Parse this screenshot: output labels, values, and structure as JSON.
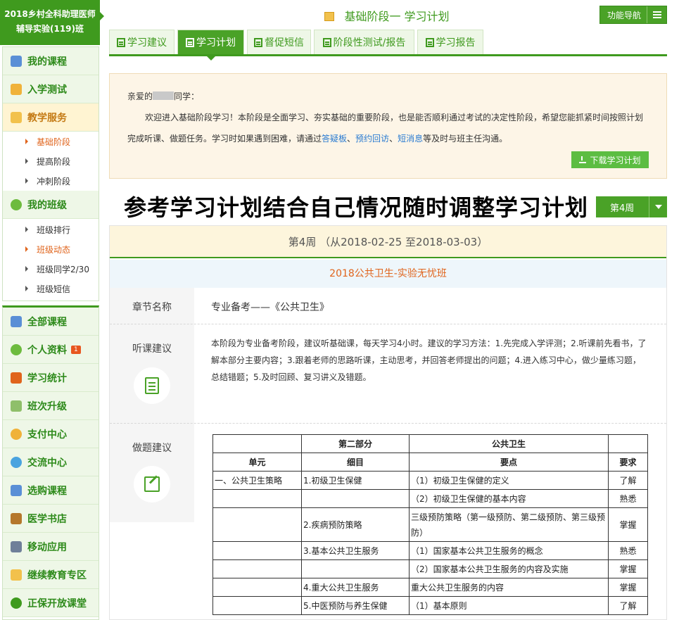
{
  "sidebar": {
    "class_title_line1": "2018乡村全科助理医师",
    "class_title_line2": "辅导实验(119)班",
    "my_courses": "我的课程",
    "entry_test": "入学测试",
    "teaching_service": "教学服务",
    "stage_basic": "基础阶段",
    "stage_advanced": "提高阶段",
    "stage_sprint": "冲刺阶段",
    "my_class": "我的班级",
    "class_ranking": "班级排行",
    "class_news": "班级动态",
    "classmates": "班级同学2/30",
    "class_sms": "班级短信",
    "all_courses": "全部课程",
    "profile": "个人资料",
    "profile_badge": "1",
    "study_stats": "学习统计",
    "class_upgrade": "班次升级",
    "payment": "支付中心",
    "communication": "交流中心",
    "buy_courses": "选购课程",
    "bookstore": "医学书店",
    "mobile_app": "移动应用",
    "continuing_edu": "继续教育专区",
    "open_class": "正保开放课堂"
  },
  "header": {
    "title": "基础阶段一 学习计划",
    "func_nav": "功能导航"
  },
  "tabs": [
    "学习建议",
    "学习计划",
    "督促短信",
    "阶段性测试/报告",
    "学习报告"
  ],
  "welcome": {
    "greet_prefix": "亲爱的",
    "greet_suffix": "同学：",
    "line1": "欢迎进入基础阶段学习！本阶段是全面学习、夯实基础的重要阶段，也是能否顺利通过考试的决定性阶段，希望您能抓紧时间按照计划",
    "line2_a": "完成听课、做题任务。学习时如果遇到困难，请通过",
    "link_qa": "答疑板",
    "sep1": "、",
    "link_appointment": "预约回访",
    "sep2": "、",
    "link_sms": "短消息",
    "line2_b": "等及时与班主任沟通。",
    "download_btn": "下载学习计划"
  },
  "banner_text": "参考学习计划结合自己情况随时调整学习计划",
  "week_select": "第4周",
  "week_panel": {
    "week_title": "第4周 （从2018-02-25 至2018-03-03）",
    "course_name": "2018公共卫生-实验无忧班",
    "label_chapter": "章节名称",
    "chapter_value": "专业备考——《公共卫生》",
    "label_listen": "听课建议",
    "listen_advice": "本阶段为专业备考阶段，建议听基础课，每天学习4小时。建议的学习方法：1.先完成入学评测；2.听课前先看书，了解本部分主要内容；3.跟着老师的思路听课，主动思考，并回答老师提出的问题；4.进入练习中心，做少量练习题，总结错题；5.及时回顾、复习讲义及错题。",
    "label_practice": "做题建议"
  },
  "plan_table": {
    "part_header": "第二部分",
    "subject_header": "公共卫生",
    "col_unit": "单元",
    "col_item": "细目",
    "col_point": "要点",
    "col_req": "要求",
    "rows": [
      {
        "unit": "一、公共卫生策略",
        "item": "1.初级卫生保健",
        "point": "（1）初级卫生保健的定义",
        "req": "了解"
      },
      {
        "unit": "",
        "item": "",
        "point": "（2）初级卫生保健的基本内容",
        "req": "熟悉"
      },
      {
        "unit": "",
        "item": "2.疾病预防策略",
        "point": "三级预防策略（第一级预防、第二级预防、第三级预防）",
        "req": "掌握"
      },
      {
        "unit": "",
        "item": "3.基本公共卫生服务",
        "point": "（1）国家基本公共卫生服务的概念",
        "req": "熟悉"
      },
      {
        "unit": "",
        "item": "",
        "point": "（2）国家基本公共卫生服务的内容及实施",
        "req": "掌握"
      },
      {
        "unit": "",
        "item": "4.重大公共卫生服务",
        "point": "重大公共卫生服务的内容",
        "req": "掌握"
      },
      {
        "unit": "",
        "item": "5.中医预防与养生保健",
        "point": "（1）基本原则",
        "req": "了解"
      }
    ]
  }
}
